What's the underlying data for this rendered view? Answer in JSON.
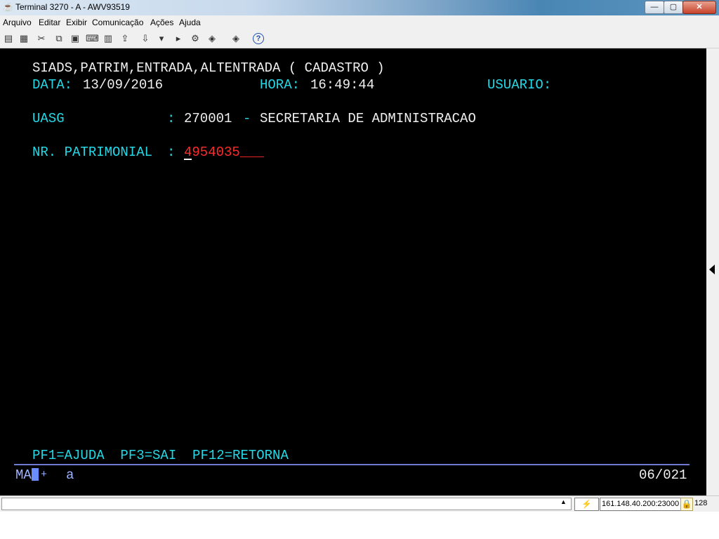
{
  "window": {
    "title": "Terminal 3270 - A - AWV93519",
    "app_icon": "java-cup-icon",
    "min_glyph": "—",
    "max_glyph": "▢",
    "close_glyph": "✕"
  },
  "menu": {
    "items": [
      "Arquivo",
      "Editar",
      "Exibir",
      "Comunicação",
      "Ações",
      "Ajuda"
    ]
  },
  "toolbar": {
    "icons": [
      {
        "name": "print-screen-icon",
        "glyph": "▤"
      },
      {
        "name": "print-icon",
        "glyph": "▦"
      },
      {
        "name": "cut-icon",
        "glyph": "✂"
      },
      {
        "name": "copy-icon",
        "glyph": "⧉"
      },
      {
        "name": "paste-icon",
        "glyph": "▣"
      },
      {
        "name": "keyboard-map-icon",
        "glyph": "⌨"
      },
      {
        "name": "grid-icon",
        "glyph": "▥"
      },
      {
        "name": "send-file-icon",
        "glyph": "⇪"
      },
      {
        "name": "receive-file-icon",
        "glyph": "⇩"
      },
      {
        "name": "macro-record-icon",
        "glyph": "▾"
      },
      {
        "name": "macro-play-icon",
        "glyph": "▸"
      },
      {
        "name": "settings-icon",
        "glyph": "⚙"
      },
      {
        "name": "script-icon",
        "glyph": "◈"
      },
      {
        "name": "help-icon",
        "glyph": "?"
      }
    ]
  },
  "terminal": {
    "header": "SIADS,PATRIM,ENTRADA,ALTENTRADA ( CADASTRO )",
    "date_label": "DATA:",
    "date_value": "13/09/2016",
    "time_label": "HORA:",
    "time_value": "16:49:44",
    "user_label": "USUARIO:",
    "uasg_label": "UASG",
    "uasg_colon": ":",
    "uasg_code": "270001",
    "uasg_sep": "-",
    "uasg_name": "SECRETARIA DE ADMINISTRACAO",
    "patrimonial_label": "NR. PATRIMONIAL",
    "patrimonial_colon": ":",
    "patrimonial_value": "4954035___",
    "function_keys": "PF1=AJUDA  PF3=SAI  PF12=RETORNA"
  },
  "oia": {
    "mode": "MA",
    "indicator": "+",
    "input_mode": "a",
    "cursor_position": "06/021"
  },
  "statusbar": {
    "host": "161.148.40.200:23000",
    "key_size": "128",
    "scroll_glyph": "▲"
  },
  "colors": {
    "screen_bg": "#000000",
    "field_label": "#24d8e6",
    "static_text": "#f0f0f0",
    "input_value": "#ff2a2a",
    "oia_text": "#9fb3ff"
  }
}
